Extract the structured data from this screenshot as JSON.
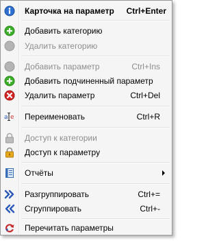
{
  "menu": {
    "items": [
      {
        "label": "Карточка на параметр",
        "shortcut": "Ctrl+Enter",
        "icon": "info-icon"
      },
      {
        "label": "Добавить категорию",
        "shortcut": "",
        "icon": "add-green-icon"
      },
      {
        "label": "Удалить категорию",
        "shortcut": "",
        "icon": "circle-gray-icon"
      },
      {
        "label": "Добавить параметр",
        "shortcut": "Ctrl+Ins",
        "icon": "circle-gray-icon"
      },
      {
        "label": "Добавить подчиненный параметр",
        "shortcut": "",
        "icon": "add-green-icon"
      },
      {
        "label": "Удалить параметр",
        "shortcut": "Ctrl+Del",
        "icon": "delete-red-icon"
      },
      {
        "label": "Переименовать",
        "shortcut": "Ctrl+R",
        "icon": "rename-icon"
      },
      {
        "label": "Доступ к категории",
        "shortcut": "",
        "icon": "lock-gray-icon"
      },
      {
        "label": "Доступ к параметру",
        "shortcut": "",
        "icon": "lock-icon"
      },
      {
        "label": "Отчёты",
        "shortcut": "",
        "icon": "report-icon"
      },
      {
        "label": "Разгруппировать",
        "shortcut": "Ctrl+=",
        "icon": "ungroup-icon"
      },
      {
        "label": "Сгруппировать",
        "shortcut": "Ctrl+-",
        "icon": "group-icon"
      },
      {
        "label": "Перечитать параметры",
        "shortcut": "",
        "icon": "reload-icon"
      }
    ]
  },
  "colors": {
    "menu_bg": "#f5f5f5",
    "disabled_text": "#8d8d8d",
    "green": "#3cae2a",
    "red": "#d42424",
    "blue": "#2a58b6"
  }
}
